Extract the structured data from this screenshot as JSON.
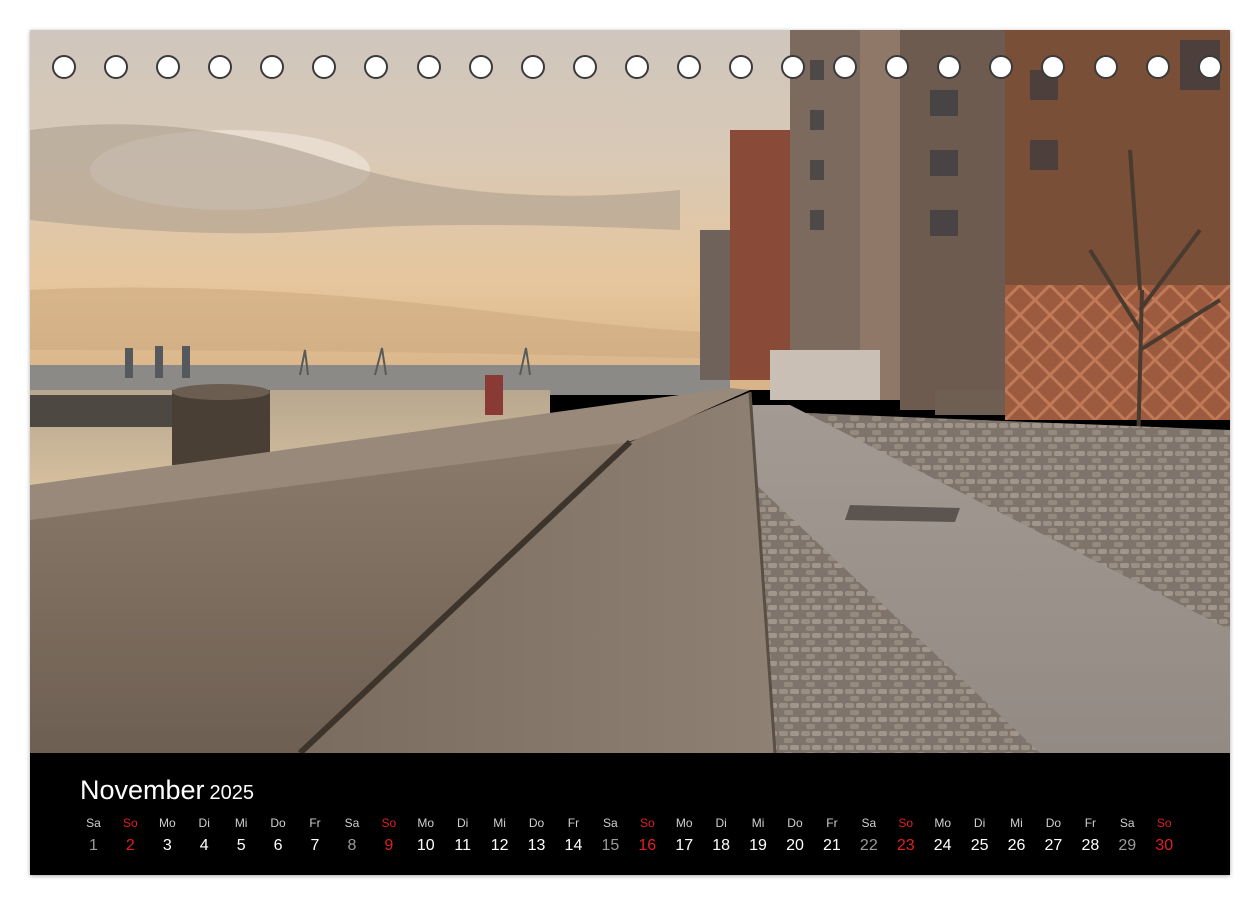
{
  "calendar": {
    "month": "November",
    "year": "2025",
    "days": [
      {
        "dow": "Sa",
        "num": "1",
        "type": "sat"
      },
      {
        "dow": "So",
        "num": "2",
        "type": "sun"
      },
      {
        "dow": "Mo",
        "num": "3",
        "type": "wd"
      },
      {
        "dow": "Di",
        "num": "4",
        "type": "wd"
      },
      {
        "dow": "Mi",
        "num": "5",
        "type": "wd"
      },
      {
        "dow": "Do",
        "num": "6",
        "type": "wd"
      },
      {
        "dow": "Fr",
        "num": "7",
        "type": "wd"
      },
      {
        "dow": "Sa",
        "num": "8",
        "type": "sat"
      },
      {
        "dow": "So",
        "num": "9",
        "type": "sun"
      },
      {
        "dow": "Mo",
        "num": "10",
        "type": "wd"
      },
      {
        "dow": "Di",
        "num": "11",
        "type": "wd"
      },
      {
        "dow": "Mi",
        "num": "12",
        "type": "wd"
      },
      {
        "dow": "Do",
        "num": "13",
        "type": "wd"
      },
      {
        "dow": "Fr",
        "num": "14",
        "type": "wd"
      },
      {
        "dow": "Sa",
        "num": "15",
        "type": "sat"
      },
      {
        "dow": "So",
        "num": "16",
        "type": "sun"
      },
      {
        "dow": "Mo",
        "num": "17",
        "type": "wd"
      },
      {
        "dow": "Di",
        "num": "18",
        "type": "wd"
      },
      {
        "dow": "Mi",
        "num": "19",
        "type": "wd"
      },
      {
        "dow": "Do",
        "num": "20",
        "type": "wd"
      },
      {
        "dow": "Fr",
        "num": "21",
        "type": "wd"
      },
      {
        "dow": "Sa",
        "num": "22",
        "type": "sat"
      },
      {
        "dow": "So",
        "num": "23",
        "type": "sun"
      },
      {
        "dow": "Mo",
        "num": "24",
        "type": "wd"
      },
      {
        "dow": "Di",
        "num": "25",
        "type": "wd"
      },
      {
        "dow": "Mi",
        "num": "26",
        "type": "wd"
      },
      {
        "dow": "Do",
        "num": "27",
        "type": "wd"
      },
      {
        "dow": "Fr",
        "num": "28",
        "type": "wd"
      },
      {
        "dow": "Sa",
        "num": "29",
        "type": "sat"
      },
      {
        "dow": "So",
        "num": "30",
        "type": "sun"
      }
    ]
  },
  "colors": {
    "sunday_red": "#e02020",
    "band_background": "#000000",
    "sky_warm": "#e8c9a0"
  }
}
